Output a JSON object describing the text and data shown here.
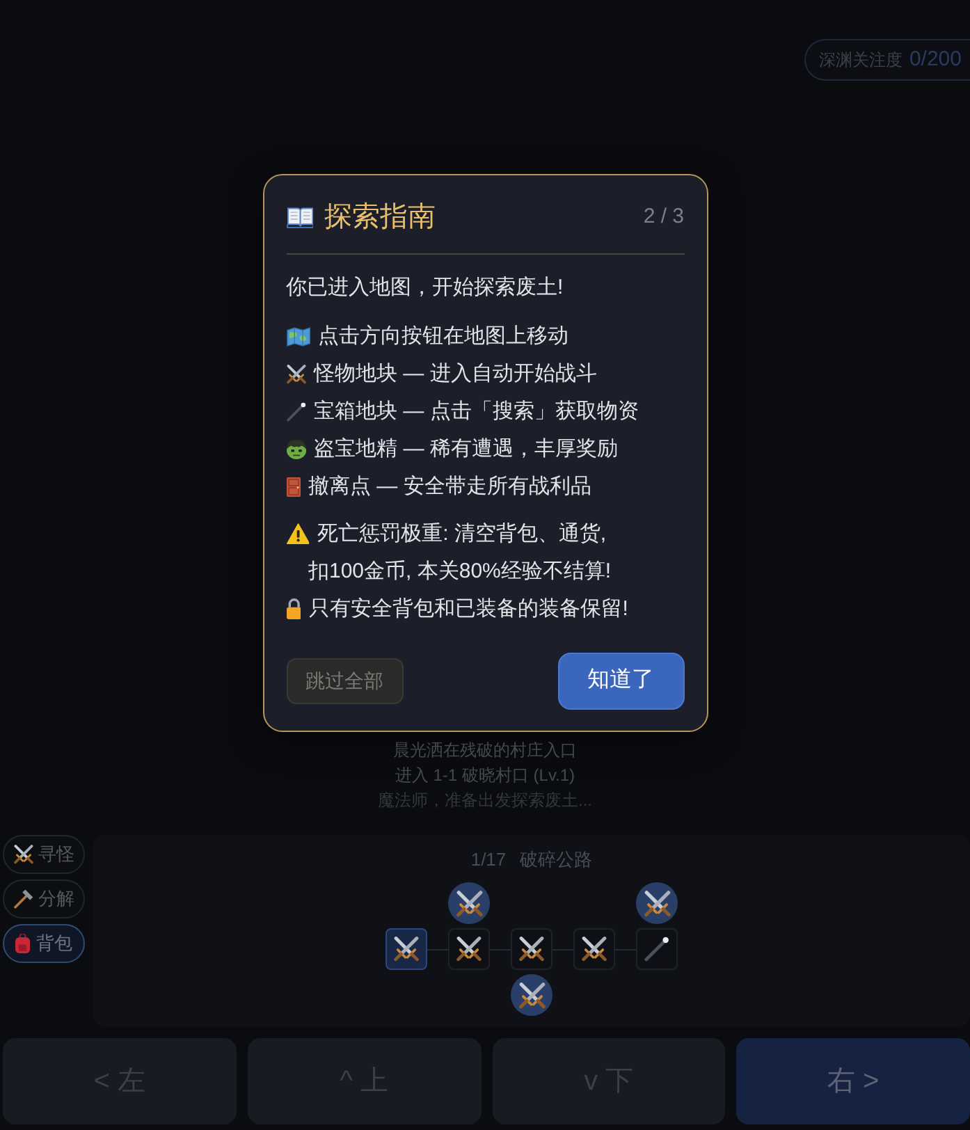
{
  "attention": {
    "label": "深渊关注度",
    "value": "0/200"
  },
  "guide": {
    "title": "探索指南",
    "page": "2 / 3",
    "intro": "你已进入地图，开始探索废土!",
    "tips": [
      {
        "kind": "map",
        "text": "点击方向按钮在地图上移动"
      },
      {
        "kind": "monster",
        "text": "怪物地块 — 进入自动开始战斗"
      },
      {
        "kind": "chest",
        "text": "宝箱地块 — 点击「搜索」获取物资"
      },
      {
        "kind": "goblin",
        "text": "盗宝地精 — 稀有遭遇，丰厚奖励"
      },
      {
        "kind": "exit",
        "text": "撤离点 — 安全带走所有战利品"
      }
    ],
    "notices": [
      {
        "kind": "warning",
        "lines": [
          "死亡惩罚极重: 清空背包、通货,",
          "扣100金币, 本关80%经验不结算!"
        ]
      },
      {
        "kind": "lock",
        "lines": [
          "只有安全背包和已装备的装备保留!"
        ]
      }
    ],
    "buttons": [
      {
        "kind": "secondary",
        "label": "跳过全部"
      },
      {
        "kind": "primary",
        "label": "知道了"
      }
    ]
  },
  "log": [
    "晨光洒在残破的村庄入口",
    "进入 1-1 破晓村口 (Lv.1)",
    "魔法师，准备出发探索废土..."
  ],
  "side_buttons": [
    {
      "kind": "hunt",
      "label": "寻怪",
      "selected": false
    },
    {
      "kind": "salvage",
      "label": "分解",
      "selected": false
    },
    {
      "kind": "bag",
      "label": "背包",
      "selected": true
    }
  ],
  "map": {
    "stage_counter": "1/17",
    "name": "破碎公路",
    "tiles": [
      {
        "kind": "monster",
        "current": true
      },
      {
        "kind": "monster",
        "current": false,
        "above": {
          "kind": "monster"
        }
      },
      {
        "kind": "monster",
        "current": false,
        "below": {
          "kind": "monster"
        }
      },
      {
        "kind": "monster",
        "current": false
      },
      {
        "kind": "chest",
        "current": false,
        "above": {
          "kind": "monster"
        }
      }
    ]
  },
  "controls": [
    {
      "label": "< 左",
      "disabled": true
    },
    {
      "label": "^ 上",
      "disabled": true
    },
    {
      "label": "v 下",
      "disabled": true
    },
    {
      "label": "右 >",
      "disabled": false
    }
  ]
}
